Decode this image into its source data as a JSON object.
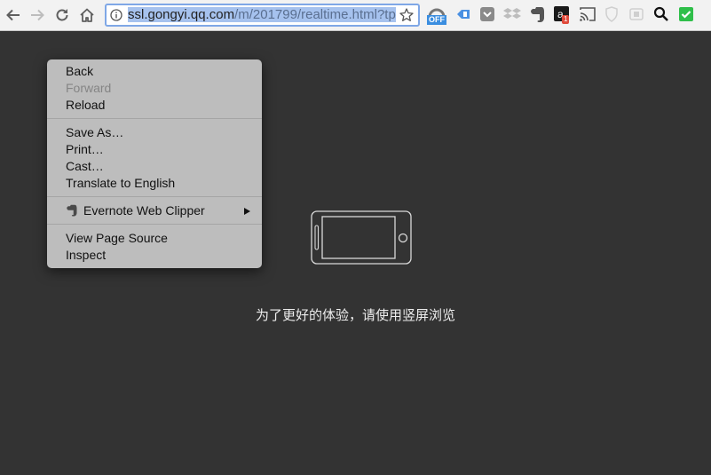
{
  "toolbar": {
    "url_host": "ssl.gongyi.qq.com",
    "url_path": "/m/201799/realtime.html?tp",
    "extensions": [
      {
        "name": "adblock-icon",
        "badge": "OFF"
      },
      {
        "name": "tag-icon"
      },
      {
        "name": "pocket-icon"
      },
      {
        "name": "dropbox-icon"
      },
      {
        "name": "evernote-icon"
      },
      {
        "name": "amazon-icon",
        "badge": "1"
      },
      {
        "name": "cast-icon"
      },
      {
        "name": "shield-icon"
      },
      {
        "name": "reader-icon"
      },
      {
        "name": "search-icon"
      },
      {
        "name": "checkmark-icon"
      }
    ]
  },
  "context_menu": {
    "items": [
      {
        "label": "Back",
        "disabled": false
      },
      {
        "label": "Forward",
        "disabled": true
      },
      {
        "label": "Reload",
        "disabled": false
      },
      {
        "label": "Save As…"
      },
      {
        "label": "Print…"
      },
      {
        "label": "Cast…"
      },
      {
        "label": "Translate to English"
      },
      {
        "label": "Evernote Web Clipper"
      },
      {
        "label": "View Page Source"
      },
      {
        "label": "Inspect"
      }
    ]
  },
  "page": {
    "hint": "为了更好的体验，请使用竖屏浏览"
  },
  "colors": {
    "page_bg": "#333333",
    "menu_bg": "#bdbdbd",
    "url_selection": "#a6c2ee"
  }
}
